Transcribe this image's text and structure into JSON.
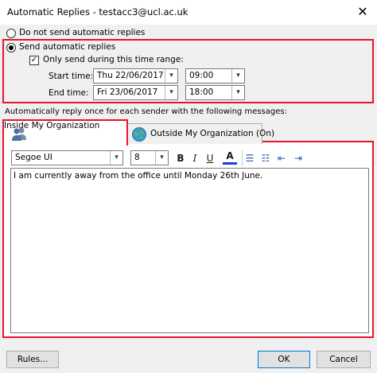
{
  "window": {
    "title": "Automatic Replies - testacc3@ucl.ac.uk",
    "close_glyph": "✕"
  },
  "options": {
    "do_not_send_label": "Do not send automatic replies",
    "send_label": "Send automatic replies",
    "only_send_label": "Only send during this time range:",
    "check_glyph": "✓"
  },
  "time_range": {
    "start_label": "Start time:",
    "start_date": "Thu 22/06/2017",
    "start_time": "09:00",
    "end_label": "End time:",
    "end_date": "Fri 23/06/2017",
    "end_time": "18:00",
    "dropdown_glyph": "▾"
  },
  "reply_heading": "Automatically reply once for each sender with the following messages:",
  "tabs": {
    "inside_label": "Inside My Organization",
    "outside_label": "Outside My Organization (On)"
  },
  "toolbar": {
    "font_name": "Segoe UI",
    "font_size": "8",
    "bold": "B",
    "italic": "I",
    "underline": "U",
    "font_color": "A",
    "bullets": "☰",
    "numbering": "☷",
    "decrease_indent": "⇤",
    "increase_indent": "⇥"
  },
  "message": {
    "body": "I am currently away from the office until Monday 26th June."
  },
  "footer": {
    "rules_label": "Rules...",
    "ok_label": "OK",
    "cancel_label": "Cancel"
  },
  "colors": {
    "highlight": "#e8142a",
    "accent": "#0078d7"
  }
}
